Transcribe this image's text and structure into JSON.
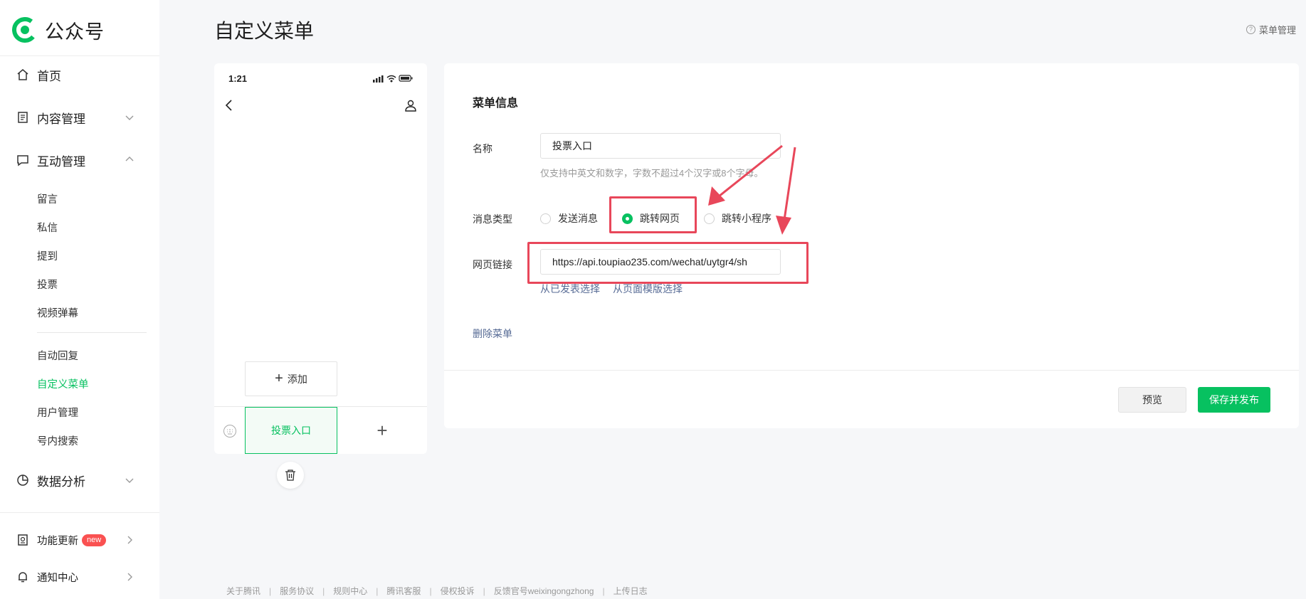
{
  "brand": {
    "name": "公众号",
    "accent": "#07c160"
  },
  "sidebar": {
    "home": "首页",
    "content": "内容管理",
    "interaction": "互动管理",
    "interaction_items": [
      "留言",
      "私信",
      "提到",
      "投票",
      "视频弹幕"
    ],
    "feature_items": [
      "自动回复",
      "自定义菜单",
      "用户管理",
      "号内搜索"
    ],
    "active_item": "自定义菜单",
    "analytics": "数据分析",
    "updates": "功能更新",
    "updates_badge": "new",
    "notifications": "通知中心"
  },
  "header": {
    "title": "自定义菜单",
    "help": "菜单管理"
  },
  "phone": {
    "time": "1:21",
    "add_label": "添加",
    "active_menu": "投票入口",
    "plus": "+"
  },
  "form": {
    "section_title": "菜单信息",
    "name_label": "名称",
    "name_value": "投票入口",
    "name_hint": "仅支持中英文和数字，字数不超过4个汉字或8个字母。",
    "type_label": "消息类型",
    "type_options": [
      "发送消息",
      "跳转网页",
      "跳转小程序"
    ],
    "type_selected": "跳转网页",
    "url_label": "网页链接",
    "url_value": "https://api.toupiao235.com/wechat/uytgr4/sh",
    "select_published": "从已发表选择",
    "select_template": "从页面模版选择",
    "delete_menu": "删除菜单",
    "preview": "预览",
    "save_publish": "保存并发布"
  },
  "annotations": {
    "highlight_color": "#e8475a"
  },
  "footer": {
    "links": [
      "关于腾讯",
      "服务协议",
      "规则中心",
      "腾讯客服",
      "侵权投诉",
      "反馈官号weixingongzhong",
      "上传日志"
    ],
    "separator": "|"
  }
}
